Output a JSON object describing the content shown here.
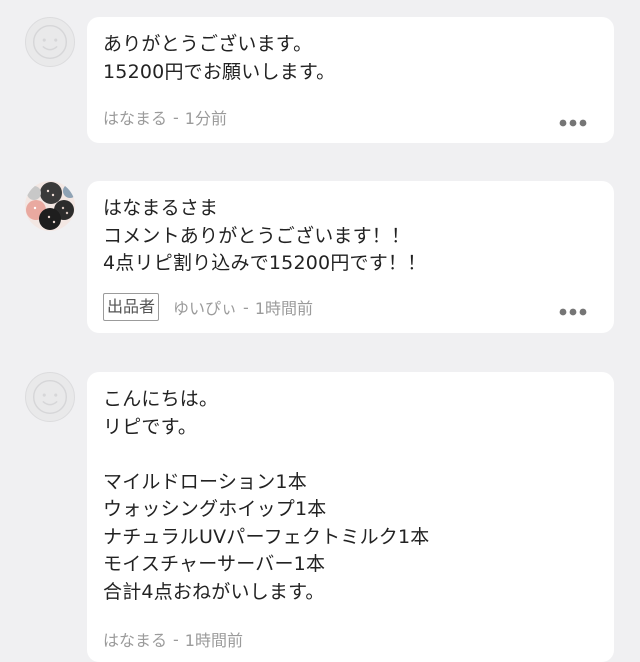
{
  "comments": [
    {
      "avatar": "default-avatar-icon",
      "body": "ありがとうございます。\n15200円でお願いします。",
      "author": "はなまる",
      "separator": "-",
      "time": "1分前"
    },
    {
      "avatar": "user-avatar-image",
      "body": "はなまるさま\nコメントありがとうございます！！\n4点リピ割り込みで15200円です！！",
      "badge": "出品者",
      "author": "ゆいぴぃ",
      "separator": "-",
      "time": "1時間前"
    },
    {
      "avatar": "default-avatar-icon",
      "body": "こんにちは。\nリピです。\n\nマイルドローション1本\nウォッシングホイップ1本\nナチュラルUVパーフェクトミルク1本\nモイスチャーサーバー1本\n合計4点おねがいします。",
      "author": "はなまる",
      "separator": "-",
      "time": "1時間前"
    }
  ],
  "more_icon": "more-horizontal-icon",
  "colors": {
    "background": "#f0f0f2",
    "bubble": "#ffffff",
    "text": "#222222",
    "meta": "#9b9b9b"
  }
}
